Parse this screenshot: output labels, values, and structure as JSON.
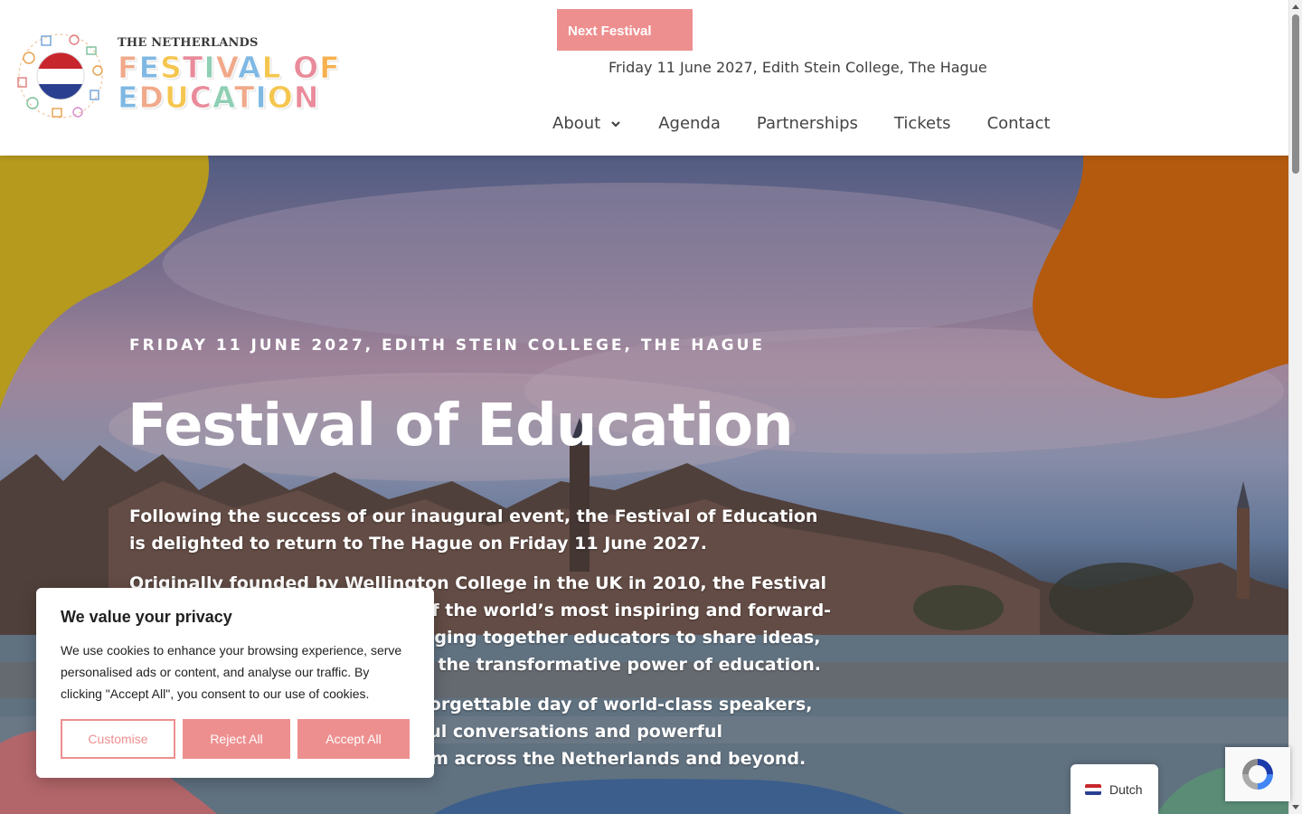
{
  "header": {
    "logo": {
      "top_text": "THE NETHERLANDS",
      "line1": "FESTIVAL OF",
      "line2": "EDUCATION"
    },
    "next_festival_label": "Next Festival",
    "date_text": "Friday 11 June 2027, Edith Stein College, The Hague",
    "nav": [
      {
        "label": "About",
        "has_dropdown": true
      },
      {
        "label": "Agenda"
      },
      {
        "label": "Partnerships"
      },
      {
        "label": "Tickets"
      },
      {
        "label": "Contact"
      }
    ]
  },
  "hero": {
    "subtitle": "FRIDAY 11 JUNE 2027, EDITH STEIN COLLEGE, THE HAGUE",
    "title": "Festival of Education",
    "paragraphs": [
      "Following the success of our inaugural event, the Festival of Education is delighted to return to The Hague on Friday 11 June 2027.",
      "Originally founded by Wellington College in the UK in 2010, the Festival of Education has become one of the world’s most inspiring and forward-thinking education events, bringing together educators to share ideas, spark innovation and celebrate the transformative power of education.",
      "Join us in The Hague for an unforgettable day of world-class speakers, inspiring workshops, meaningful conversations and powerful connections with educators from across the Netherlands and beyond."
    ]
  },
  "cookie_banner": {
    "title": "We value your privacy",
    "text": "We use cookies to enhance your browsing experience, serve personalised ads or content, and analyse our traffic. By clicking \"Accept All\", you consent to our use of cookies.",
    "customise_label": "Customise",
    "reject_label": "Reject All",
    "accept_label": "Accept All"
  },
  "language_switcher": {
    "label": "Dutch",
    "flag_icon": "netherlands-flag-icon"
  },
  "colors": {
    "accent": "#ee8f8f",
    "blob_yellow": "#b59a1e",
    "blob_orange": "#b35a0f",
    "blob_red": "#b3666a",
    "blob_blue": "#3b5e8c",
    "blob_green": "#5a8c76"
  }
}
